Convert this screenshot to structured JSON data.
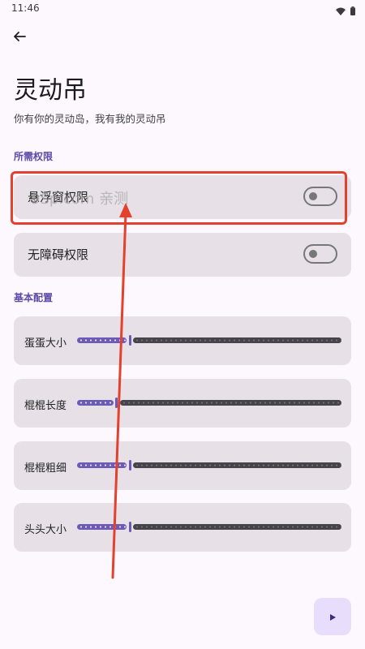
{
  "status_bar": {
    "time": "11:46"
  },
  "header": {
    "title": "灵动吊",
    "subtitle": "你有你的灵动岛，我有我的灵动吊"
  },
  "sections": {
    "permissions_label": "所需权限",
    "basic_config_label": "基本配置"
  },
  "permissions": [
    {
      "label": "悬浮窗权限",
      "enabled": false
    },
    {
      "label": "无障碍权限",
      "enabled": false
    }
  ],
  "sliders": [
    {
      "label": "蛋蛋大小",
      "fraction": 0.2
    },
    {
      "label": "棍棍长度",
      "fraction": 0.15
    },
    {
      "label": "棍棍粗细",
      "fraction": 0.2
    },
    {
      "label": "头头大小",
      "fraction": 0.2
    }
  ],
  "watermark": "9Sp.com 亲测",
  "colors": {
    "accent": "#6C5AB6",
    "highlight": "#E2412E",
    "card": "#E7E0E6",
    "background": "#FDF8FD"
  },
  "icons": {
    "back": "arrow-left-icon",
    "play": "play-icon",
    "wifi": "wifi-icon",
    "battery": "battery-icon"
  }
}
